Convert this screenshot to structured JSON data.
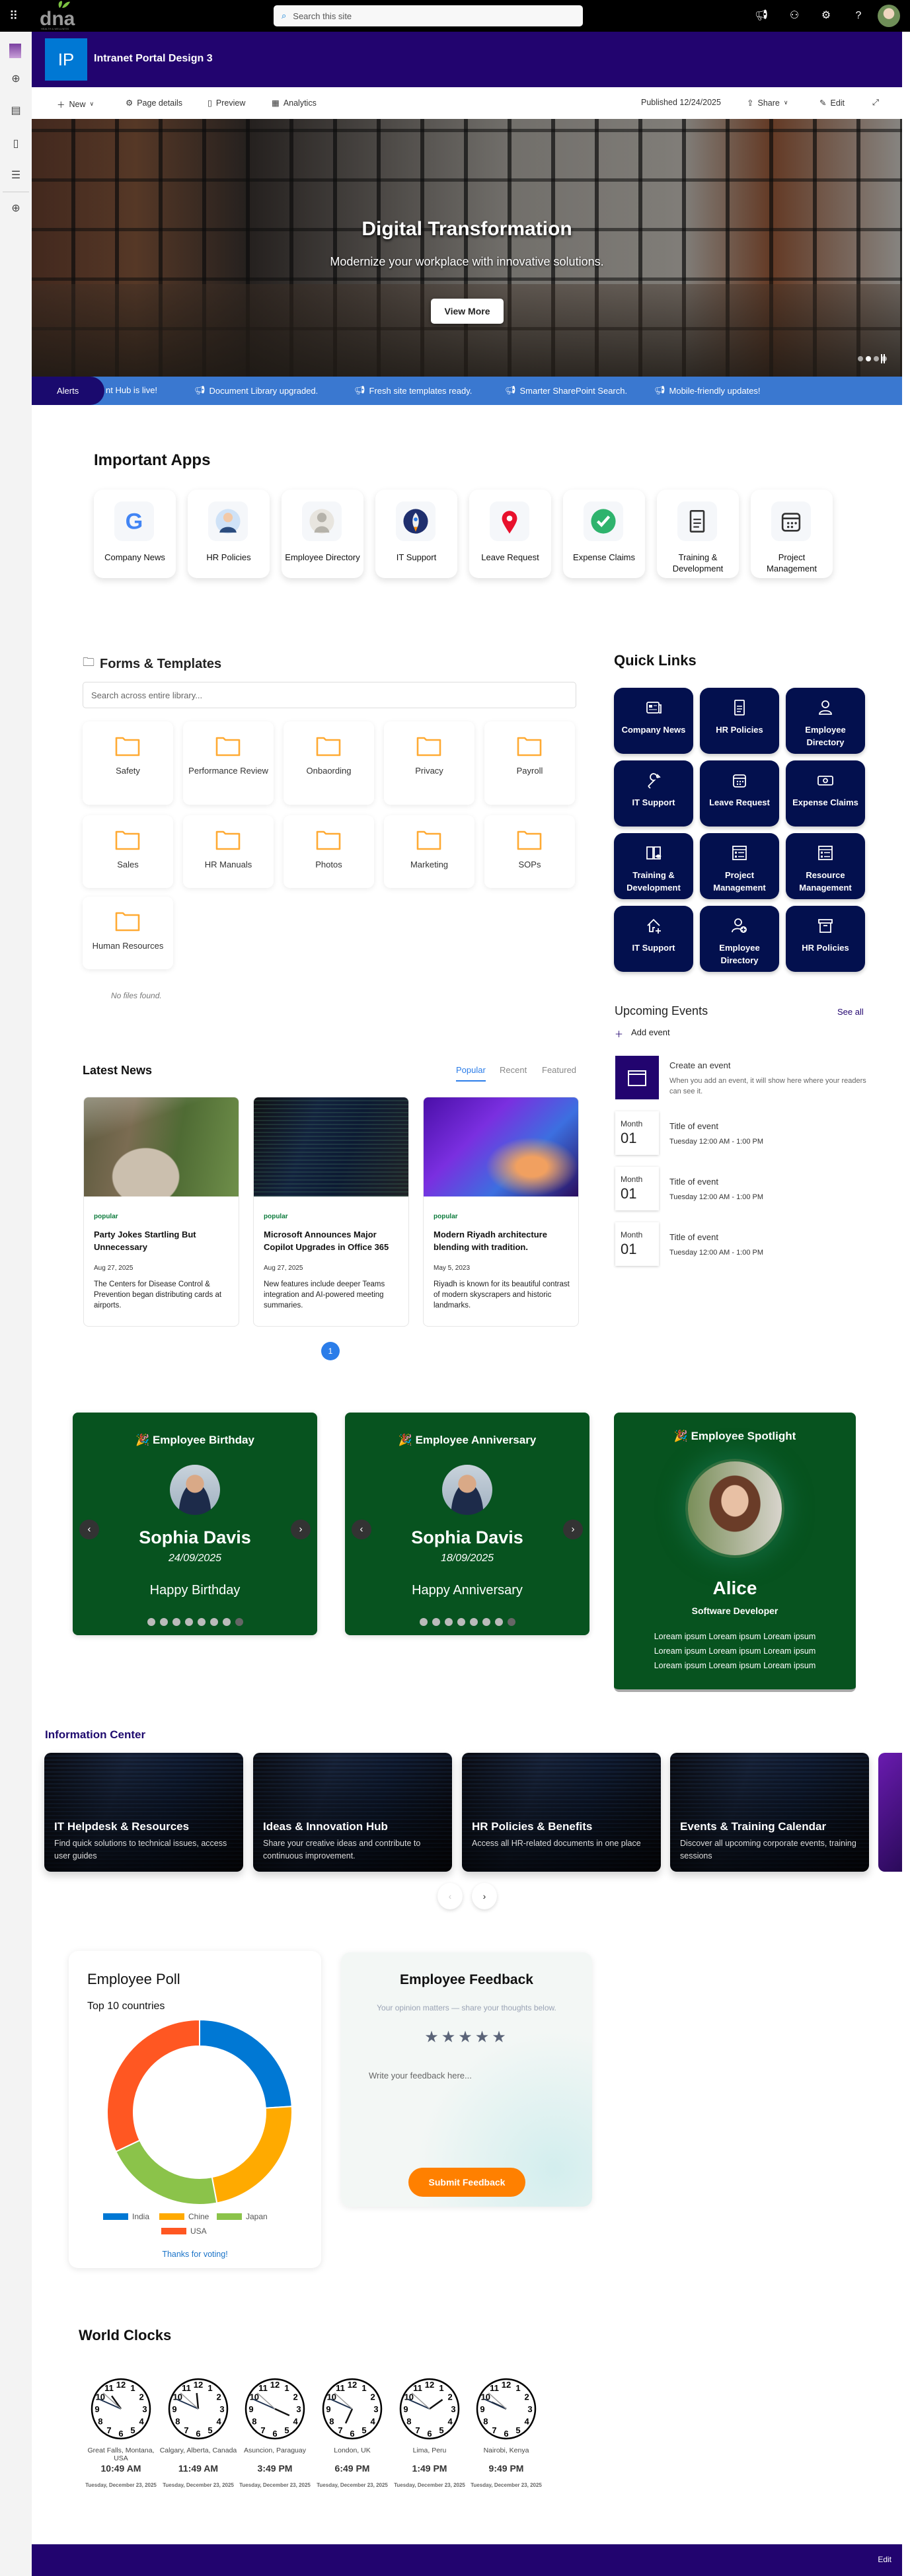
{
  "topbar": {
    "logo_text": "dna",
    "logo_tagline": "HEALTH & WELLNESS",
    "search_placeholder": "Search this site"
  },
  "header": {
    "site_initials": "IP",
    "site_title": "Intranet Portal Design 3"
  },
  "commandbar": {
    "new": "New",
    "page_details": "Page details",
    "preview": "Preview",
    "analytics": "Analytics",
    "published": "Published 12/24/2025",
    "share": "Share",
    "edit": "Edit"
  },
  "hero": {
    "title": "Digital Transformation",
    "subtitle": "Modernize your workplace with innovative solutions.",
    "button": "View More",
    "slide_count": 4,
    "active_slide": 2
  },
  "alerts": {
    "label": "Alerts",
    "items": [
      "nt Hub is live!",
      "Document Library upgraded.",
      "Fresh site templates ready.",
      "Smarter SharePoint Search.",
      "Mobile-friendly updates!"
    ]
  },
  "apps": {
    "title": "Important Apps",
    "items": [
      {
        "label": "Company News",
        "icon": "google-icon"
      },
      {
        "label": "HR Policies",
        "icon": "businessman-icon"
      },
      {
        "label": "Employee Directory",
        "icon": "person-silhouette-icon"
      },
      {
        "label": "IT Support",
        "icon": "rocket-icon"
      },
      {
        "label": "Leave Request",
        "icon": "map-pin-icon"
      },
      {
        "label": "Expense Claims",
        "icon": "check-circle-icon"
      },
      {
        "label": "Training & Development",
        "icon": "document-icon"
      },
      {
        "label": "Project Management",
        "icon": "calendar-icon"
      }
    ]
  },
  "forms": {
    "title": "Forms & Templates",
    "search_placeholder": "Search across entire library...",
    "folders": [
      "Safety",
      "Performance Review",
      "Onbaording",
      "Privacy",
      "Payroll",
      "Sales",
      "HR Manuals",
      "Photos",
      "Marketing",
      "SOPs",
      "Human Resources"
    ],
    "empty": "No files found."
  },
  "quick_links": {
    "title": "Quick Links",
    "items": [
      {
        "label": "Company News",
        "icon": "newspaper-icon"
      },
      {
        "label": "HR Policies",
        "icon": "document-icon"
      },
      {
        "label": "Employee Directory",
        "icon": "person-icon"
      },
      {
        "label": "IT Support",
        "icon": "wrench-icon"
      },
      {
        "label": "Leave Request",
        "icon": "calendar-icon"
      },
      {
        "label": "Expense Claims",
        "icon": "money-icon"
      },
      {
        "label": "Training & Development",
        "icon": "book-icon"
      },
      {
        "label": "Project Management",
        "icon": "list-icon"
      },
      {
        "label": "Resource Management",
        "icon": "list-icon"
      },
      {
        "label": "IT Support",
        "icon": "home-add-icon"
      },
      {
        "label": "Employee Directory",
        "icon": "person-add-icon"
      },
      {
        "label": "HR Policies",
        "icon": "archive-icon"
      }
    ]
  },
  "events": {
    "title": "Upcoming Events",
    "see_all": "See all",
    "add": "Add event",
    "create_title": "Create an event",
    "create_desc": "When you add an event, it will show here where your readers can see it.",
    "items": [
      {
        "month": "Month",
        "day": "01",
        "title": "Title of event",
        "time": "Tuesday 12:00 AM - 1:00 PM"
      },
      {
        "month": "Month",
        "day": "01",
        "title": "Title of event",
        "time": "Tuesday 12:00 AM - 1:00 PM"
      },
      {
        "month": "Month",
        "day": "01",
        "title": "Title of event",
        "time": "Tuesday 12:00 AM - 1:00 PM"
      }
    ]
  },
  "news": {
    "title": "Latest News",
    "tabs": [
      "Popular",
      "Recent",
      "Featured"
    ],
    "active_tab": 0,
    "page": "1",
    "items": [
      {
        "tag": "popular",
        "title": "Party Jokes Startling But Unnecessary",
        "date": "Aug 27, 2025",
        "desc": "The Centers for Disease Control & Prevention began distributing cards at airports."
      },
      {
        "tag": "popular",
        "title": "Microsoft Announces Major Copilot Upgrades in Office 365",
        "date": "Aug 27, 2025",
        "desc": "New features include deeper Teams integration and AI-powered meeting summaries."
      },
      {
        "tag": "popular",
        "title": "Modern Riyadh architecture blending with tradition.",
        "date": "May 5, 2023",
        "desc": "Riyadh is known for its beautiful contrast of modern skyscrapers and historic landmarks."
      }
    ]
  },
  "celebrations": [
    {
      "title": "Employee Birthday",
      "name": "Sophia Davis",
      "date": "24/09/2025",
      "message": "Happy Birthday",
      "dots": 8,
      "active_dot": 8
    },
    {
      "title": "Employee Anniversary",
      "name": "Sophia Davis",
      "date": "18/09/2025",
      "message": "Happy Anniversary",
      "dots": 8,
      "active_dot": 8
    }
  ],
  "spotlight": {
    "title": "Employee Spotlight",
    "name": "Alice",
    "role": "Software Developer",
    "lines": [
      "Loream ipsum Loream ipsum Loream ipsum",
      "Loream ipsum Loream ipsum Loream ipsum",
      "Loream ipsum Loream ipsum Loream ipsum"
    ]
  },
  "info_center": {
    "title": "Information Center",
    "items": [
      {
        "title": "IT Helpdesk & Resources",
        "desc": "Find quick solutions to technical issues, access user guides"
      },
      {
        "title": "Ideas & Innovation Hub",
        "desc": "Share your creative ideas and contribute to continuous improvement."
      },
      {
        "title": "HR Policies & Benefits",
        "desc": "Access all HR-related documents in one place"
      },
      {
        "title": "Events & Training Calendar",
        "desc": "Discover all upcoming corporate events, training sessions"
      }
    ]
  },
  "poll": {
    "title": "Employee Poll",
    "thanks": "Thanks for voting!"
  },
  "chart_data": {
    "type": "pie",
    "donut": true,
    "title": "Top 10 countries",
    "categories": [
      "India",
      "Chine",
      "Japan",
      "USA"
    ],
    "values": [
      24,
      23,
      21,
      32
    ],
    "colors": [
      "#0078d4",
      "#ffaa00",
      "#8bc34a",
      "#ff5722"
    ],
    "legend": "bottom"
  },
  "feedback": {
    "title": "Employee Feedback",
    "subtitle": "Your opinion matters — share your thoughts below.",
    "stars": 5,
    "rating": 0,
    "placeholder": "Write your feedback here...",
    "button": "Submit Feedback"
  },
  "clocks": {
    "title": "World Clocks",
    "items": [
      {
        "city": "Great Falls, Montana, USA",
        "time": "10:49 AM",
        "date": "Tuesday, December 23, 2025",
        "h": 10,
        "m": 49,
        "s": 52
      },
      {
        "city": "Calgary, Alberta, Canada",
        "time": "11:49 AM",
        "date": "Tuesday, December 23, 2025",
        "h": 11,
        "m": 49,
        "s": 52
      },
      {
        "city": "Asuncion, Paraguay",
        "time": "3:49 PM",
        "date": "Tuesday, December 23, 2025",
        "h": 15,
        "m": 49,
        "s": 52
      },
      {
        "city": "London, UK",
        "time": "6:49 PM",
        "date": "Tuesday, December 23, 2025",
        "h": 18,
        "m": 49,
        "s": 52
      },
      {
        "city": "Lima, Peru",
        "time": "1:49 PM",
        "date": "Tuesday, December 23, 2025",
        "h": 13,
        "m": 49,
        "s": 52
      },
      {
        "city": "Nairobi, Kenya",
        "time": "9:49 PM",
        "date": "Tuesday, December 23, 2025",
        "h": 21,
        "m": 49,
        "s": 52
      }
    ]
  },
  "footer": {
    "edit": "Edit"
  }
}
